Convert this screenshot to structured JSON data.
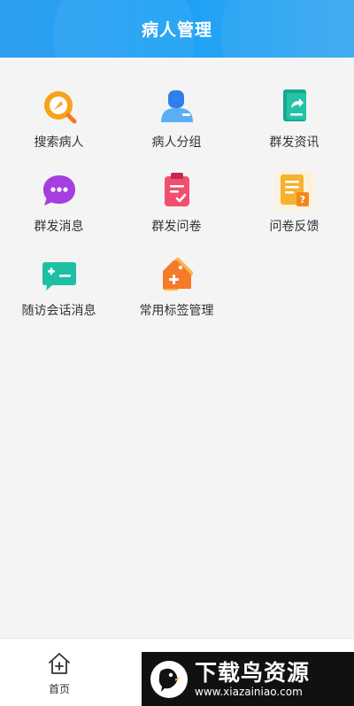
{
  "header": {
    "title": "病人管理"
  },
  "menu": {
    "items": [
      {
        "label": "搜索病人",
        "icon": "search-patient-icon",
        "color": "#f5a623"
      },
      {
        "label": "病人分组",
        "icon": "patient-group-icon",
        "color": "#3b8df0"
      },
      {
        "label": "群发资讯",
        "icon": "mass-info-icon",
        "color": "#1fb5a0"
      },
      {
        "label": "群发消息",
        "icon": "mass-message-icon",
        "color": "#a73fe0"
      },
      {
        "label": "群发问卷",
        "icon": "mass-questionnaire-icon",
        "color": "#f0506e"
      },
      {
        "label": "问卷反馈",
        "icon": "questionnaire-feedback-icon",
        "color": "#f5b53a"
      },
      {
        "label": "随访会话消息",
        "icon": "followup-chat-icon",
        "color": "#1ec3a0"
      },
      {
        "label": "常用标签管理",
        "icon": "tag-manage-icon",
        "color": "#f57a2a"
      }
    ]
  },
  "tabbar": {
    "home_label": "首页"
  },
  "watermark": {
    "title": "下载鸟资源",
    "url": "www.xiazainiao.com"
  }
}
